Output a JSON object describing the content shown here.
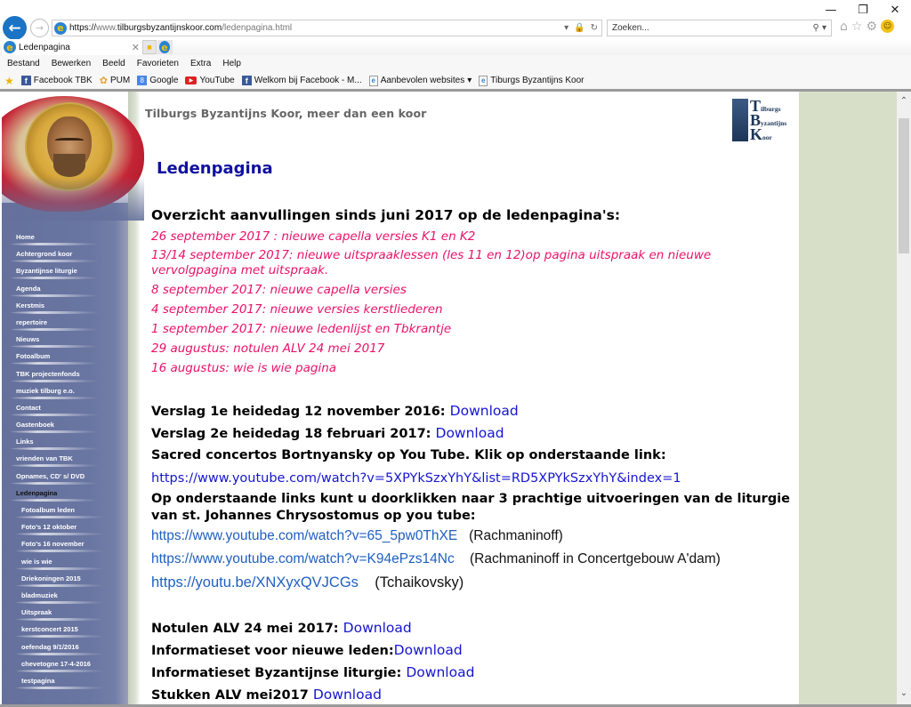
{
  "window": {
    "minimize_icon": "minimize-icon",
    "restore_icon": "restore-icon",
    "close_icon": "close-icon"
  },
  "browser": {
    "address": {
      "scheme": "https://",
      "host_prefix": "www.",
      "host": "tilburgsbyzantijnskoor.com",
      "path": "/ledenpagina.html"
    },
    "search_placeholder": "Zoeken...",
    "tab": {
      "label": "Ledenpagina"
    },
    "menu": [
      "Bestand",
      "Bewerken",
      "Beeld",
      "Favorieten",
      "Extra",
      "Help"
    ],
    "favorites": [
      {
        "label": "Facebook TBK",
        "icon": "facebook-icon"
      },
      {
        "label": "PUM",
        "icon": "pum-icon"
      },
      {
        "label": "Google",
        "icon": "google-icon"
      },
      {
        "label": "YouTube",
        "icon": "youtube-icon"
      },
      {
        "label": "Welkom bij Facebook - M...",
        "icon": "facebook-icon"
      },
      {
        "label": "Aanbevolen websites",
        "icon": "ie-page-icon",
        "dropdown": true
      },
      {
        "label": "Tiburgs Byzantijns Koor",
        "icon": "ie-page-icon"
      }
    ]
  },
  "site": {
    "slogan": "Tilburgs Byzantijns Koor, meer dan een koor",
    "logo": {
      "lines": [
        {
          "big": "T",
          "small": "ilburgs"
        },
        {
          "big": "B",
          "small": "yzantijns"
        },
        {
          "big": "K",
          "small": "oor"
        }
      ]
    },
    "page_title": "Ledenpagina",
    "nav": [
      {
        "label": "Home",
        "sub": false
      },
      {
        "label": "Achtergrond koor",
        "sub": false
      },
      {
        "label": "Byzantijnse liturgie",
        "sub": false
      },
      {
        "label": "Agenda",
        "sub": false
      },
      {
        "label": "Kerstmis",
        "sub": false
      },
      {
        "label": "repertoire",
        "sub": false
      },
      {
        "label": "Nieuws",
        "sub": false
      },
      {
        "label": "Fotoalbum",
        "sub": false
      },
      {
        "label": "TBK projectenfonds",
        "sub": false
      },
      {
        "label": "muziek tilburg e.o.",
        "sub": false
      },
      {
        "label": "Contact",
        "sub": false
      },
      {
        "label": "Gastenboek",
        "sub": false
      },
      {
        "label": "Links",
        "sub": false
      },
      {
        "label": "vrienden van TBK",
        "sub": false
      },
      {
        "label": "Opnames, CD' s/ DVD",
        "sub": false
      },
      {
        "label": "Ledenpagina",
        "sub": false,
        "active": true
      },
      {
        "label": "Fotoalbum leden",
        "sub": true
      },
      {
        "label": "Foto's 12 oktober",
        "sub": true
      },
      {
        "label": "Foto's 16 november",
        "sub": true
      },
      {
        "label": "wie is wie",
        "sub": true
      },
      {
        "label": "Driekoningen 2015",
        "sub": true
      },
      {
        "label": "bladmuziek",
        "sub": true
      },
      {
        "label": "Uitspraak",
        "sub": true
      },
      {
        "label": "kerstconcert 2015",
        "sub": true
      },
      {
        "label": "oefendag 9/1/2016",
        "sub": true
      },
      {
        "label": "chevetogne 17-4-2016",
        "sub": true
      },
      {
        "label": "testpagina",
        "sub": true
      }
    ],
    "overview": {
      "heading": "Overzicht aanvullingen sinds juni 2017 op de ledenpagina's:",
      "updates": [
        "26 september 2017 : nieuwe capella versies K1 en K2",
        "13/14 september 2017: nieuwe uitspraaklessen (les 11 en 12)op pagina uitspraak en nieuwe vervolgpagina met uitspraak.",
        "8 september 2017: nieuwe capella versies",
        "4 september 2017: nieuwe versies kerstliederen",
        "1 september 2017: nieuwe ledenlijst en Tbkrantje",
        "29 augustus: notulen ALV 24 mei 2017",
        "16 augustus: wie is wie pagina"
      ]
    },
    "downloads_1": [
      {
        "label": "Verslag 1e heidedag 12 november 2016: ",
        "link": "Download"
      },
      {
        "label": "Verslag 2e heidedag 18 februari 2017: ",
        "link": "Download"
      }
    ],
    "bortnyansky": {
      "text": "Sacred concertos Bortnyansky op You Tube. Klik op onderstaande link:",
      "url": "https://www.youtube.com/watch?v=5XPYkSzxYhY&list=RD5XPYkSzxYhY&index=1"
    },
    "liturgy": {
      "text": "Op onderstaande links kunt u doorklikken naar 3 prachtige uitvoeringen van de liturgie van st. Johannes Chrysostomus op you tube:",
      "videos": [
        {
          "url": "https://www.youtube.com/watch?v=65_5pw0ThXE",
          "note": "(Rachmaninoff)"
        },
        {
          "url": "https://www.youtube.com/watch?v=K94ePzs14Nc",
          "note": "(Rachmaninoff in Concertgebouw A'dam)"
        },
        {
          "url": "https://youtu.be/XNXyxQVJCGs",
          "note": "(Tchaikovsky)"
        }
      ]
    },
    "downloads_2": [
      {
        "label": "Notulen ALV 24 mei 2017: ",
        "link": "Download"
      },
      {
        "label": "Informatieset voor nieuwe leden:",
        "link": "Download"
      },
      {
        "label": "Informatieset Byzantijnse liturgie: ",
        "link": "Download"
      },
      {
        "label": "Stukken ALV mei2017 ",
        "link": "Download"
      }
    ]
  },
  "colors": {
    "update_pink": "#e8126a",
    "link_blue": "#1515d0",
    "title_blue": "#1010a0",
    "sidebar_blue": "#6a76a2",
    "right_band": "#d7dfc9"
  }
}
